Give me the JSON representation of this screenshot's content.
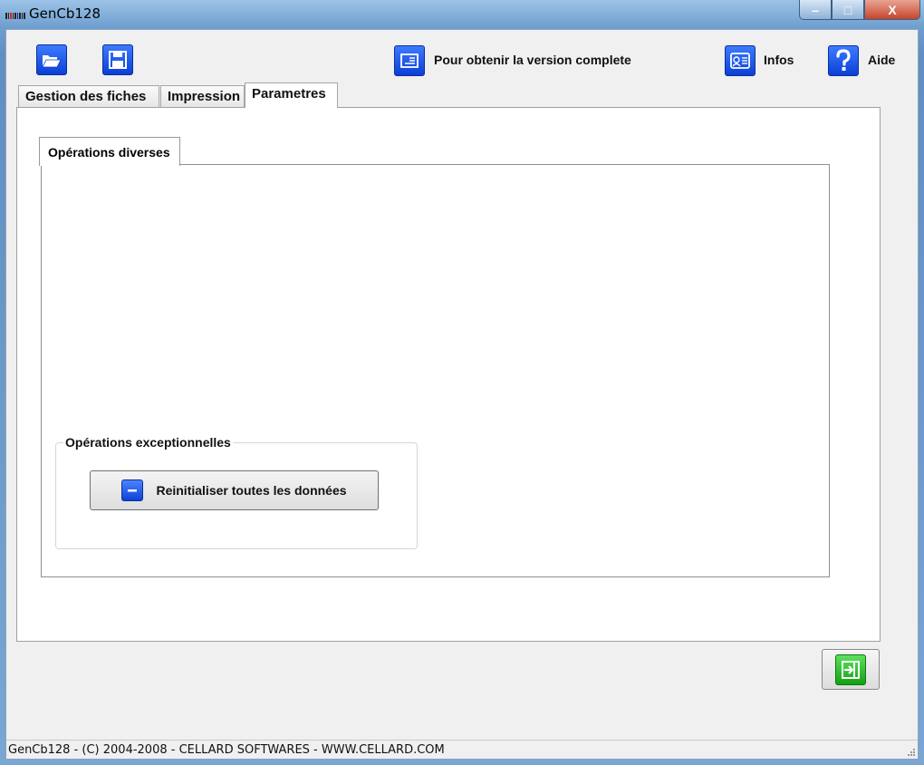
{
  "window": {
    "title": "GenCb128",
    "controls": {
      "minimize": "–",
      "maximize": "□",
      "close": "X"
    }
  },
  "toolbar": {
    "open_icon": "folder-open-icon",
    "save_icon": "floppy-save-icon",
    "full_version_label": "Pour obtenir la version complete",
    "infos_label": "Infos",
    "aide_label": "Aide"
  },
  "tabs": [
    {
      "label": "Gestion des fiches",
      "active": false
    },
    {
      "label": "Impression",
      "active": false
    },
    {
      "label": "Parametres",
      "active": true
    }
  ],
  "parametres": {
    "subtab_label": "Opérations diverses",
    "group_title": "Opérations exceptionnelles",
    "reset_button_label": "Reinitialiser toutes les données"
  },
  "statusbar": {
    "text": "GenCb128 - (C) 2004-2008 - CELLARD SOFTWARES - WWW.CELLARD.COM"
  },
  "colors": {
    "accent_blue": "#1552f0",
    "exit_green": "#1bb01b"
  }
}
